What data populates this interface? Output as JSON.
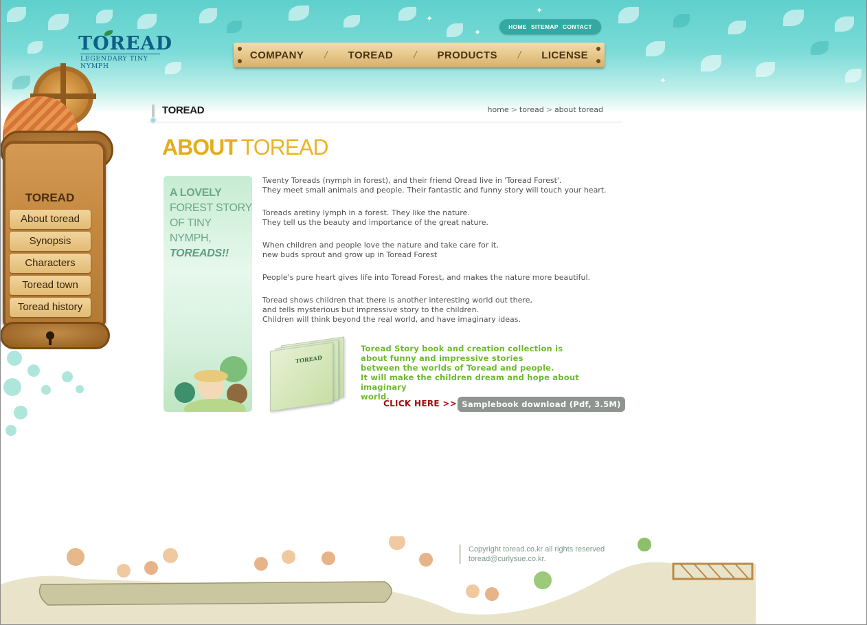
{
  "brand": {
    "logo_text": "TOREAD",
    "logo_tagline": "LEGENDARY TINY NYMPH"
  },
  "util_nav": [
    {
      "label": "HOME"
    },
    {
      "label": "SITEMAP"
    },
    {
      "label": "CONTACT"
    }
  ],
  "main_nav": [
    {
      "label": "COMPANY"
    },
    {
      "label": "TOREAD"
    },
    {
      "label": "PRODUCTS"
    },
    {
      "label": "LICENSE"
    }
  ],
  "sidebar": {
    "title": "TOREAD",
    "items": [
      {
        "label": "About toread"
      },
      {
        "label": "Synopsis"
      },
      {
        "label": "Characters"
      },
      {
        "label": "Toread town"
      },
      {
        "label": "Toread history"
      }
    ]
  },
  "section": {
    "title": "TOREAD",
    "breadcrumb": [
      "home",
      "toread",
      "about toread"
    ]
  },
  "heading": {
    "bold": "ABOUT",
    "light": "TOREAD"
  },
  "banner": {
    "lines": [
      "A LOVELY",
      "FOREST STORY",
      "OF TINY NYMPH,"
    ],
    "emphasis": "TOREADS!!"
  },
  "copy": {
    "paragraphs": [
      "Twenty Toreads (nymph in forest), and their friend Oread live in 'Toread Forest'.\nThey meet small animals and people. Their fantastic and funny story will touch your heart.",
      "Toreads aretiny lymph in a forest. They like the nature.\nThey tell us the beauty and importance of the great nature.",
      "When children and people love the nature and take care for it,\nnew buds sprout and grow up in Toread Forest",
      "People's pure heart gives life into Toread Forest, and makes the nature more beautiful.",
      "Toread shows children that there is another interesting world out there,\nand tells mysterious but impressive story to the children.\nChildren will think beyond the real world, and have imaginary ideas."
    ]
  },
  "promo": {
    "book_cover_title": "TOREAD",
    "text": "Toread Story book and creation collection is\nabout funny and impressive stories\nbetween the worlds of Toread and people.\nIt will make the children dream and hope about imaginary\nworld.",
    "click_here": "CLICK HERE >>",
    "download_label": "Samplebook download (Pdf, 3.5M)"
  },
  "footer": {
    "copyright": "Copyright toread.co.kr all rights reserved",
    "email": "toread@curlysue.co.kr."
  },
  "colors": {
    "teal_header": "#5fd0cc",
    "heading_gold": "#e4ad1b",
    "promo_green": "#6cba2c",
    "click_red": "#a10e0e",
    "wood": "#c48840"
  }
}
